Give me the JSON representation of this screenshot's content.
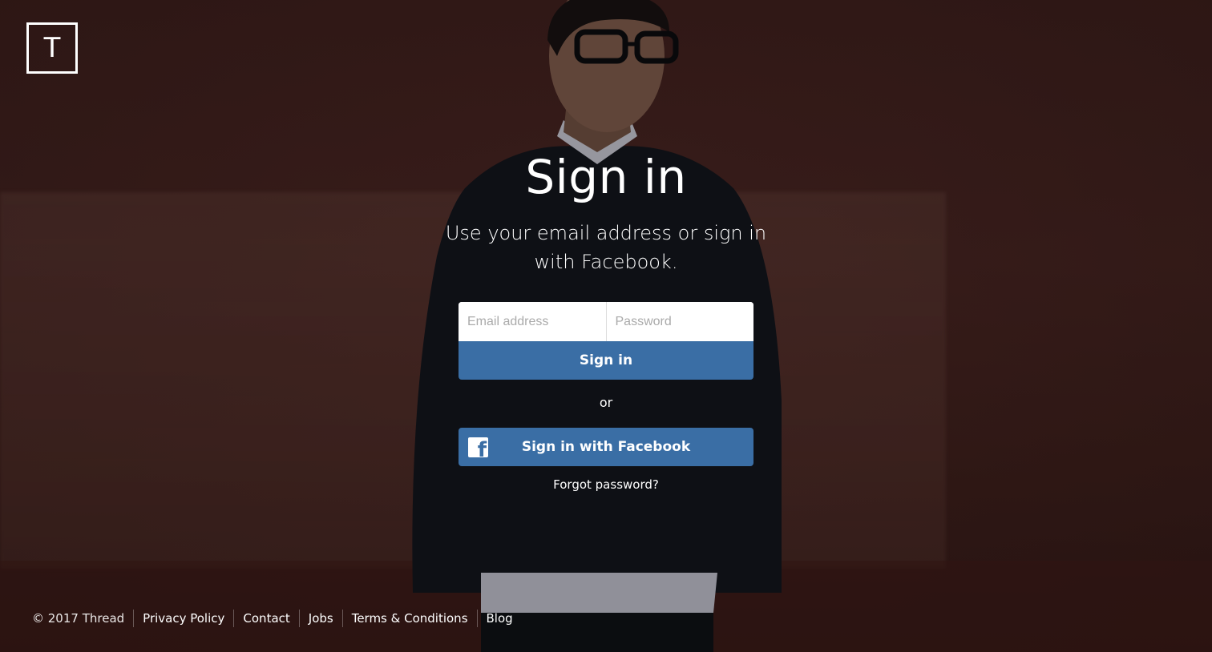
{
  "logo": {
    "letter": "T"
  },
  "heading": {
    "title": "Sign in",
    "subtitle": "Use your email address or sign in with Facebook."
  },
  "form": {
    "email_placeholder": "Email address",
    "password_placeholder": "Password",
    "submit_label": "Sign in",
    "or_label": "or",
    "facebook_label": "Sign in with Facebook",
    "forgot_label": "Forgot password?"
  },
  "footer": {
    "copyright": "© 2017 Thread",
    "links": [
      "Privacy Policy",
      "Contact",
      "Jobs",
      "Terms & Conditions",
      "Blog"
    ]
  },
  "colors": {
    "button_blue": "#3a6ea5",
    "background": "#4a2724"
  },
  "icons": {
    "facebook": "facebook-icon"
  }
}
